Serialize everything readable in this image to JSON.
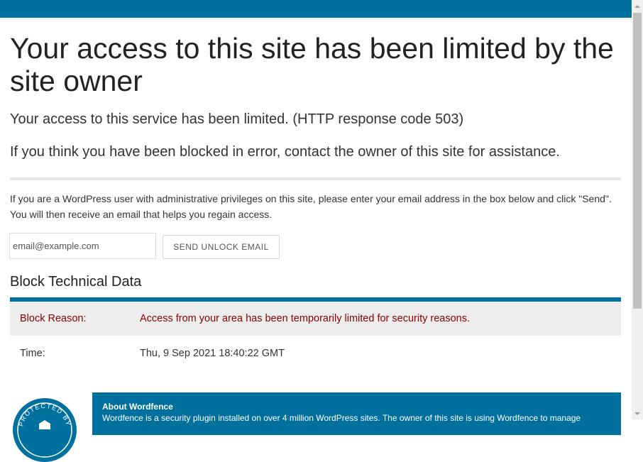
{
  "page": {
    "title": "Your access to this site has been limited by the site owner",
    "limited_message": "Your access to this service has been limited. (HTTP response code 503)",
    "error_message": "If you think you have been blocked in error, contact the owner of this site for assistance.",
    "admin_message": "If you are a WordPress user with administrative privileges on this site, please enter your email address in the box below and click \"Send\". You will then receive an email that helps you regain access."
  },
  "unlock_form": {
    "email_placeholder": "email@example.com",
    "button_label": "SEND UNLOCK EMAIL"
  },
  "block_data": {
    "heading": "Block Technical Data",
    "rows": [
      {
        "label": "Block Reason:",
        "value": "Access from your area has been temporarily limited for security reasons."
      },
      {
        "label": "Time:",
        "value": "Thu, 9 Sep 2021 18:40:22 GMT"
      }
    ]
  },
  "about": {
    "title": "About Wordfence",
    "text": "Wordfence is a security plugin installed on over 4 million WordPress sites. The owner of this site is using Wordfence to manage",
    "badge_text": "PROTECTED BY"
  },
  "colors": {
    "accent": "#00709e",
    "reason_text": "#8b0000",
    "row_highlight": "#ededed"
  }
}
